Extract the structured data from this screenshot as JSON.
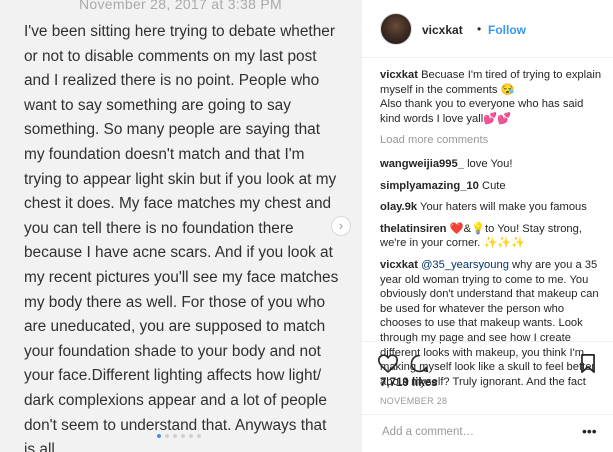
{
  "note": {
    "date": "November 28, 2017 at 3:38 PM",
    "body": "I've been sitting here trying to debate whether\nor not to disable comments on my last post\nand I realized there is no point. People who\nwant to say something are going to say\nsomething. So many people are saying that\nmy foundation doesn't match and that I'm\ntrying to appear light skin but if you look at my\nchest it does. My face matches my chest and\nyou can tell there is no foundation there\nbecause I have acne scars. And if you look at\nmy recent pictures you'll see my face matches\nmy body there as well. For those of you who\nare uneducated, you are supposed to match\nyour foundation shade to your body and not\nyour face.Different lighting affects how light/\ndark complexions appear and a lot of people\ndon't seem to understand that. Anyways that\nis all.",
    "next_icon": "›"
  },
  "header": {
    "username": "vicxkat",
    "separator": "•",
    "follow_label": "Follow"
  },
  "caption": {
    "user": "vicxkat",
    "text": "Becuase I'm tired of trying to explain myself in the comments 😪\nAlso thank you to everyone who has said kind words I love yall💕💕"
  },
  "load_more_label": "Load more comments",
  "comments": [
    {
      "user": "wangweijia995_",
      "text": "love You!"
    },
    {
      "user": "simplyamazing_10",
      "text": "Cute"
    },
    {
      "user": "olay.9k",
      "text": "Your haters will make you famous"
    },
    {
      "user": "thelatinsiren",
      "text": "❤️&💡to You! Stay strong, we're in your corner. ✨✨✨"
    },
    {
      "user": "vicxkat",
      "mention": "@35_yearsyoung",
      "text": " why are you a 35 year old woman trying to come to me. You obviously don't understand that makeup can be used for whatever the person who chooses to use that makeup wants. Look through my page and see how I create different looks with makeup, you think I'm making myself look like a skull to feel better about myself? Truly ignorant. And the fact"
    }
  ],
  "likes": "7,719 likes",
  "date": "NOVEMBER 28",
  "add_comment_placeholder": "Add a comment…",
  "more_label": "•••",
  "colors": {
    "link": "#3897f0",
    "text": "#262626",
    "muted": "#999999",
    "note_bg": "#f2f2f2"
  },
  "icons": [
    "heart-icon",
    "comment-icon",
    "bookmark-icon",
    "next-arrow-icon",
    "more-options-icon"
  ]
}
